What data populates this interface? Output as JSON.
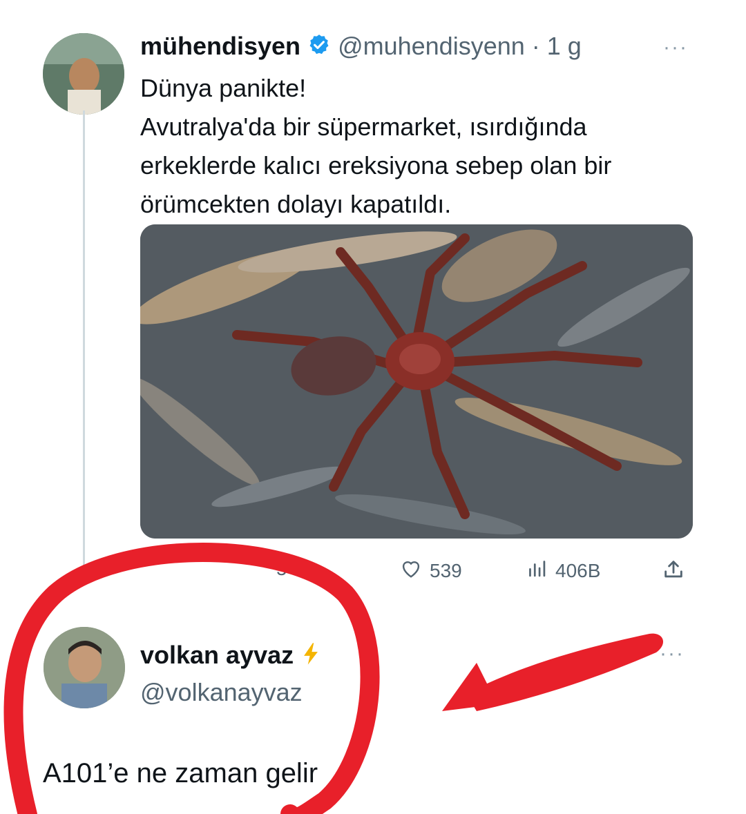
{
  "tweet": {
    "author_name": "mühendisyen",
    "handle_time": "@muhendisyenn · 1 g",
    "lines": [
      "Dünya panikte!",
      "Avutralya'da bir süpermarket, ısırdığında",
      "erkeklerde kalıcı ereksiyona sebep olan bir",
      "örümcekten dolayı kapatıldı."
    ],
    "retweets": "54",
    "likes": "539",
    "views": "406B",
    "icons": [
      "verified-badge",
      "heart-icon",
      "views-icon",
      "share-icon",
      "more-icon"
    ]
  },
  "reply": {
    "author_name": "volkan ayvaz",
    "handle": "@volkanayvaz",
    "text": "A101’e ne zaman gelir",
    "icons": [
      "lightning-badge",
      "more-icon"
    ]
  },
  "colors": {
    "verified": "#1d9bf0",
    "annotation": "#e8202a",
    "lightning": "#f4b400"
  }
}
